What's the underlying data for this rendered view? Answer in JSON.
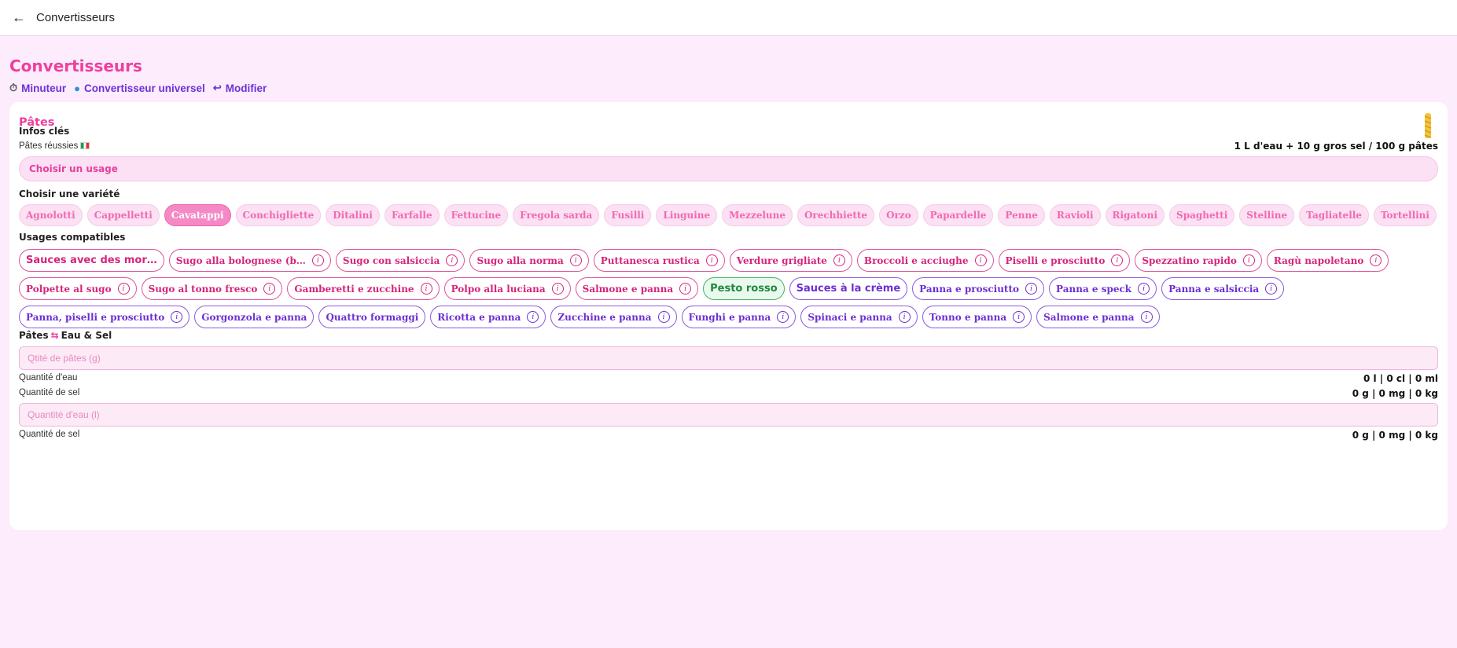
{
  "topbar": {
    "back_icon": "arrow-left-icon",
    "title": "Convertisseurs"
  },
  "page_title": "Convertisseurs",
  "quicklinks": [
    {
      "icon": "stopwatch-icon",
      "label": "Minuteur"
    },
    {
      "icon": "globe-icon",
      "label": "Convertisseur universel"
    },
    {
      "icon": "return-arrow-icon",
      "label": "Modifier"
    }
  ],
  "card": {
    "title": "Pâtes",
    "icon": "pasta-icon",
    "key_info_label": "Infos clés",
    "tip_label": "Pâtes réussies",
    "tip_value": "1 L d'eau + 10 g gros sel / 100 g pâtes",
    "usage_select": "Choisir un usage",
    "variety_label": "Choisir une variété",
    "varieties": [
      "Agnolotti",
      "Cappelletti",
      "Cavatappi",
      "Conchigliette",
      "Ditalini",
      "Farfalle",
      "Fettucine",
      "Fregola sarda",
      "Fusilli",
      "Linguine",
      "Mezzelune",
      "Orechhiette",
      "Orzo",
      "Papardelle",
      "Penne",
      "Ravioli",
      "Rigatoni",
      "Spaghetti",
      "Stelline",
      "Tagliatelle",
      "Tortellini"
    ],
    "active_variety": "Cavatappi",
    "usages_label": "Usages compatibles",
    "usages": [
      {
        "label": "Sauces avec des mor…",
        "style": "pink big",
        "info": false
      },
      {
        "label": "Sugo alla bolognese (b…",
        "style": "pink",
        "info": true
      },
      {
        "label": "Sugo con salsiccia",
        "style": "pink",
        "info": true
      },
      {
        "label": "Sugo alla norma",
        "style": "pink",
        "info": true
      },
      {
        "label": "Puttanesca rustica",
        "style": "pink",
        "info": true
      },
      {
        "label": "Verdure grigliate",
        "style": "pink",
        "info": true
      },
      {
        "label": "Broccoli e acciughe",
        "style": "pink",
        "info": true
      },
      {
        "label": "Piselli e prosciutto",
        "style": "pink",
        "info": true
      },
      {
        "label": "Spezzatino rapido",
        "style": "pink",
        "info": true
      },
      {
        "label": "Ragù napoletano",
        "style": "pink",
        "info": true
      },
      {
        "label": "Polpette al sugo",
        "style": "pink",
        "info": true
      },
      {
        "label": "Sugo al tonno fresco",
        "style": "pink",
        "info": true
      },
      {
        "label": "Gamberetti e zucchine",
        "style": "pink",
        "info": true
      },
      {
        "label": "Polpo alla luciana",
        "style": "pink",
        "info": true
      },
      {
        "label": "Salmone e panna",
        "style": "pink",
        "info": true
      },
      {
        "label": "Pesto rosso",
        "style": "green",
        "info": false
      },
      {
        "label": "Sauces à la crème",
        "style": "purple big",
        "info": false
      },
      {
        "label": "Panna e prosciutto",
        "style": "purple",
        "info": true
      },
      {
        "label": "Panna e speck",
        "style": "purple",
        "info": true
      },
      {
        "label": "Panna e salsiccia",
        "style": "purple",
        "info": true
      },
      {
        "label": "Panna, piselli e prosciutto",
        "style": "purple",
        "info": true
      },
      {
        "label": "Gorgonzola e panna",
        "style": "purple",
        "info": false
      },
      {
        "label": "Quattro formaggi",
        "style": "purple",
        "info": false
      },
      {
        "label": "Ricotta e panna",
        "style": "purple",
        "info": true
      },
      {
        "label": "Zucchine e panna",
        "style": "purple",
        "info": true
      },
      {
        "label": "Funghi e panna",
        "style": "purple",
        "info": true
      },
      {
        "label": "Spinaci e panna",
        "style": "purple",
        "info": true
      },
      {
        "label": "Tonno e panna",
        "style": "purple",
        "info": true
      },
      {
        "label": "Salmone e panna",
        "style": "purple",
        "info": true
      }
    ],
    "converter": {
      "left": "Pâtes",
      "swap_icon": "swap-icon",
      "right": "Eau & Sel",
      "pasta_placeholder": "Qtité de pâtes (g)",
      "water_label": "Quantité d'eau",
      "water_value": "0 l  |  0 cl  |  0 ml",
      "salt_label": "Quantité de sel",
      "salt_value": "0 g  |  0 mg  |  0 kg",
      "water_placeholder": "Quantité d'eau (l)",
      "salt_label2": "Quantité de sel",
      "salt_value2": "0 g  |  0 mg  |  0 kg"
    }
  }
}
